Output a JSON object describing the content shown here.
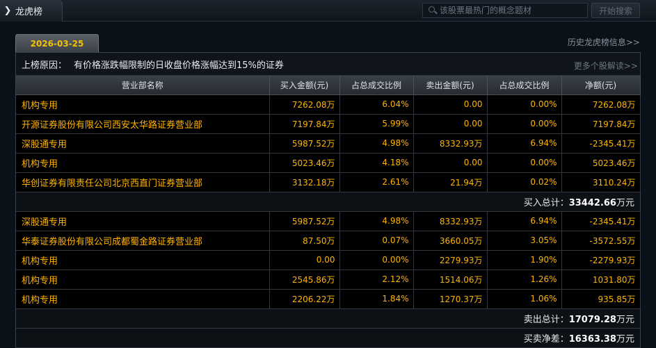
{
  "app": {
    "title": "龙虎榜",
    "title_arrow": "❯",
    "search_placeholder": "该股票最热门的概念题材",
    "search_button": "开始搜索"
  },
  "date_tab": "2026-03-25",
  "history_link": "历史龙虎榜信息>>",
  "reason": {
    "label": "上榜原因：",
    "text": "有价格涨跌幅限制的日收盘价格涨幅达到15%的证券",
    "more_link": "更多个股解读>>"
  },
  "columns": [
    "营业部名称",
    "买入金额(元)",
    "占总成交比例",
    "卖出金额(元)",
    "占总成交比例",
    "净额(元)"
  ],
  "buy_rows": [
    [
      "机构专用",
      "7262.08万",
      "6.04%",
      "0.00",
      "0.00%",
      "7262.08万"
    ],
    [
      "开源证券股份有限公司西安太华路证券营业部",
      "7197.84万",
      "5.99%",
      "0.00",
      "0.00%",
      "7197.84万"
    ],
    [
      "深股通专用",
      "5987.52万",
      "4.98%",
      "8332.93万",
      "6.94%",
      "-2345.41万"
    ],
    [
      "机构专用",
      "5023.46万",
      "4.18%",
      "0.00",
      "0.00%",
      "5023.46万"
    ],
    [
      "华创证券有限责任公司北京西直门证券营业部",
      "3132.18万",
      "2.61%",
      "21.94万",
      "0.02%",
      "3110.24万"
    ]
  ],
  "buy_total": {
    "label": "买入总计：",
    "value": "33442.66",
    "unit": "万元"
  },
  "sell_rows": [
    [
      "深股通专用",
      "5987.52万",
      "4.98%",
      "8332.93万",
      "6.94%",
      "-2345.41万"
    ],
    [
      "华泰证券股份有限公司成都蜀金路证券营业部",
      "87.50万",
      "0.07%",
      "3660.05万",
      "3.05%",
      "-3572.55万"
    ],
    [
      "机构专用",
      "0.00",
      "0.00%",
      "2279.93万",
      "1.90%",
      "-2279.93万"
    ],
    [
      "机构专用",
      "2545.86万",
      "2.12%",
      "1514.06万",
      "1.26%",
      "1031.80万"
    ],
    [
      "机构专用",
      "2206.22万",
      "1.84%",
      "1270.37万",
      "1.06%",
      "935.85万"
    ]
  ],
  "sell_total": {
    "label": "卖出总计：",
    "value": "17079.28",
    "unit": "万元"
  },
  "net_total": {
    "label": "买卖净差：",
    "value": "16363.38",
    "unit": "万元"
  },
  "colors": {
    "accent": "#ffb400",
    "date_text": "#f2c200",
    "background": "#000000"
  }
}
